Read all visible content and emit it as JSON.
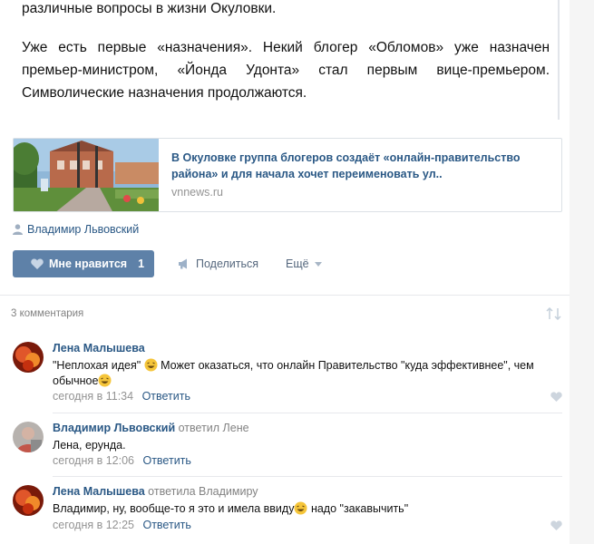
{
  "post": {
    "paragraph_1": "различные вопросы в жизни Окуловки.",
    "paragraph_2": "Уже есть первые «назначения». Некий блогер «Обломов» уже назначен премьер-министром, «Йонда Удонта» стал первым вице-премьером. Символические назначения продолжаются.",
    "link_card": {
      "title": "В Окуловке группа блогеров создаёт «онлайн-правительство района» и для начала хочет переименовать ул..",
      "domain": "vnnews.ru"
    },
    "author": "Владимир Львовский",
    "actions": {
      "like_label": "Мне нравится",
      "like_count": "1",
      "share_label": "Поделиться",
      "more_label": "Ещё"
    }
  },
  "comments": {
    "header": "3 комментария",
    "items": [
      {
        "author": "Лена Малышева",
        "reply_to": "",
        "text_before": "\"Неплохая идея\"",
        "text_mid": " Может оказаться, что онлайн Правительство \"куда эффективнее\", чем обычное",
        "text_after": "",
        "time": "сегодня в 11:34",
        "reply": "Ответить"
      },
      {
        "author": "Владимир Львовский",
        "reply_to": "ответил Лене",
        "text": "Лена, ерунда.",
        "time": "сегодня в 12:06",
        "reply": "Ответить"
      },
      {
        "author": "Лена Малышева",
        "reply_to": "ответила Владимиру",
        "text_before": "Владимир, ну, вообще-то я это и имела ввиду",
        "text_after": " надо \"закавычить\"",
        "time": "сегодня в 12:25",
        "reply": "Ответить"
      }
    ]
  },
  "colors": {
    "link": "#2a5885",
    "like_button": "#5e81a8",
    "muted": "#939393"
  },
  "icons": [
    "person-icon",
    "heart-icon",
    "megaphone-icon",
    "chevron-down-icon",
    "sort-icon",
    "laugh-emoji-icon"
  ]
}
